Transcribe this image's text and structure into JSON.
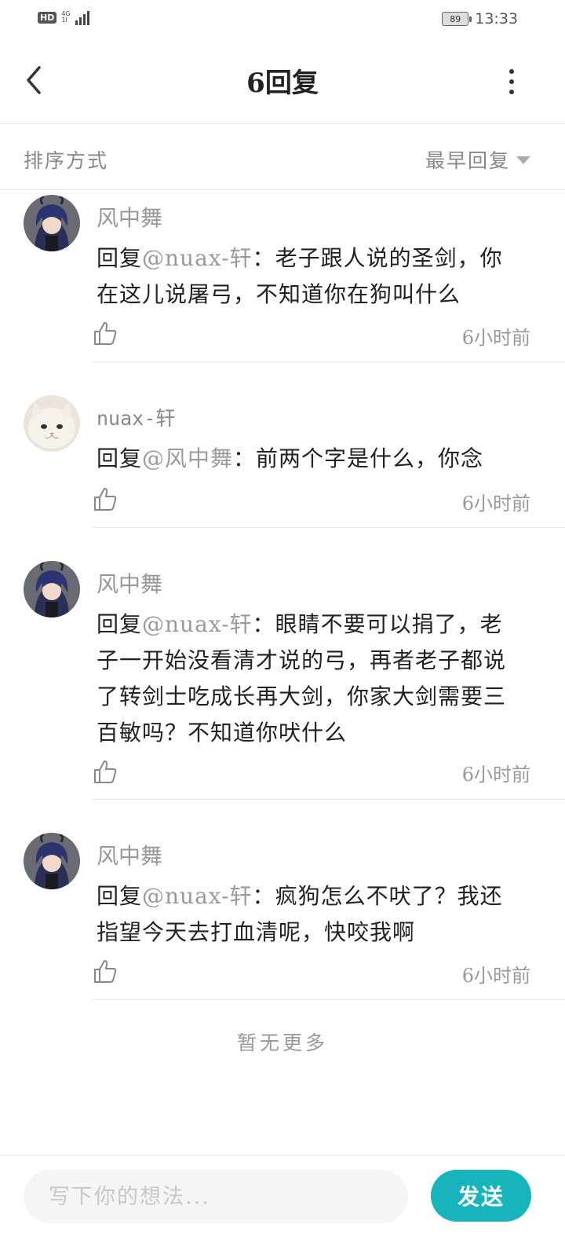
{
  "status_bar": {
    "hd": "HD",
    "network": "4G",
    "network_sub": "1l",
    "battery": "89",
    "time": "13:33"
  },
  "header": {
    "back_icon": "chevron-left-icon",
    "title": "6回复",
    "more_icon": "more-vertical-icon"
  },
  "sort": {
    "label": "排序方式",
    "value": "最早回复",
    "caret_icon": "caret-down-icon"
  },
  "comments": [
    {
      "author": "风中舞",
      "reply_prefix": "回复",
      "mention": "@nuax-轩",
      "colon": "：",
      "text": "老子跟人说的圣剑，你在这儿说屠弓，不知道你在狗叫什么",
      "time": "6小时前",
      "avatar": "anime-character-avatar"
    },
    {
      "author": "nuax-轩",
      "reply_prefix": "回复",
      "mention": "@风中舞",
      "colon": "：",
      "text": "前两个字是什么，你念",
      "time": "6小时前",
      "avatar": "white-cat-avatar"
    },
    {
      "author": "风中舞",
      "reply_prefix": "回复",
      "mention": "@nuax-轩",
      "colon": "：",
      "text": "眼睛不要可以捐了，老子一开始没看清才说的弓，再者老子都说了转剑士吃成长再大剑，你家大剑需要三百敏吗？不知道你吠什么",
      "time": "6小时前",
      "avatar": "anime-character-avatar"
    },
    {
      "author": "风中舞",
      "reply_prefix": "回复",
      "mention": "@nuax-轩",
      "colon": "：",
      "text": "疯狗怎么不吠了？我还指望今天去打血清呢，快咬我啊",
      "time": "6小时前",
      "avatar": "anime-character-avatar"
    }
  ],
  "footer_note": "暂无更多",
  "composer": {
    "placeholder": "写下你的想法...",
    "send_label": "发送"
  },
  "colors": {
    "accent": "#18b4bc",
    "mention": "#9a9a9a",
    "muted": "#999999"
  }
}
